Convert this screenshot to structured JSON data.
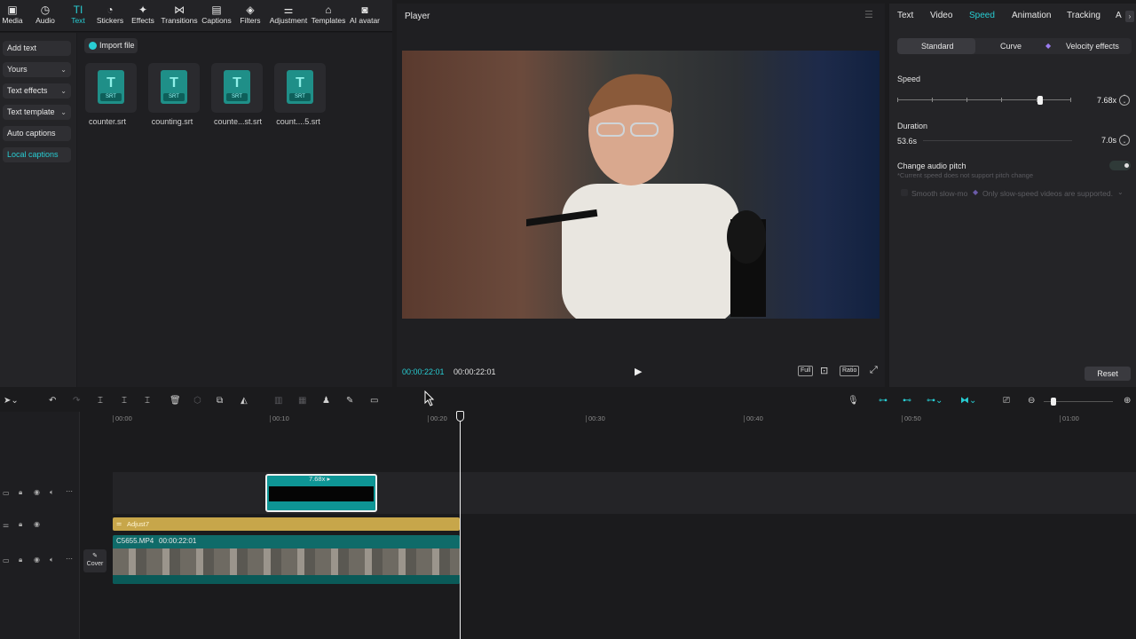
{
  "toolbar": {
    "items": [
      {
        "label": "Media",
        "icon": "media-icon"
      },
      {
        "label": "Audio",
        "icon": "audio-icon"
      },
      {
        "label": "Text",
        "icon": "text-icon"
      },
      {
        "label": "Stickers",
        "icon": "sticker-icon"
      },
      {
        "label": "Effects",
        "icon": "effects-icon"
      },
      {
        "label": "Transitions",
        "icon": "transition-icon"
      },
      {
        "label": "Captions",
        "icon": "captions-icon"
      },
      {
        "label": "Filters",
        "icon": "filters-icon"
      },
      {
        "label": "Adjustment",
        "icon": "adjustment-icon"
      },
      {
        "label": "Templates",
        "icon": "templates-icon"
      },
      {
        "label": "AI avatar",
        "icon": "avatar-icon"
      }
    ],
    "active": "Text"
  },
  "left_nav": {
    "items": [
      {
        "label": "Add text"
      },
      {
        "label": "Yours"
      },
      {
        "label": "Text effects"
      },
      {
        "label": "Text template"
      },
      {
        "label": "Auto captions"
      },
      {
        "label": "Local captions"
      }
    ]
  },
  "media": {
    "import_label": "Import file",
    "files": [
      {
        "name": "counter.srt",
        "badge": "SRT"
      },
      {
        "name": "counting.srt",
        "badge": "SRT"
      },
      {
        "name": "counte...st.srt",
        "badge": "SRT"
      },
      {
        "name": "count....5.srt",
        "badge": "SRT"
      }
    ]
  },
  "player": {
    "title": "Player",
    "current_time": "00:00:22:01",
    "total_time": "00:00:22:01",
    "controls": [
      "Full",
      "Ratio"
    ]
  },
  "right_panel": {
    "tabs": [
      "Text",
      "Video",
      "Speed",
      "Animation",
      "Tracking",
      "A"
    ],
    "active_tab": "Speed",
    "modes": [
      "Standard",
      "Curve",
      "Velocity effects"
    ],
    "active_mode": "Standard",
    "speed_label": "Speed",
    "speed_value": "7.68x",
    "speed_fraction": 0.82,
    "duration_label": "Duration",
    "duration_original": "53.6s",
    "duration_value": "7.0s",
    "pitch_label": "Change audio pitch",
    "pitch_note": "*Current speed does not support pitch change",
    "slowmo_label": "Smooth slow-mo",
    "slowmo_note": "Only slow-speed videos are supported.",
    "reset_label": "Reset"
  },
  "timeline": {
    "ruler": [
      "00:00",
      "00:10",
      "00:20",
      "00:30",
      "00:40",
      "00:50",
      "01:00"
    ],
    "speed_clip_label": "7.68x",
    "adjust_label": "Adjust7",
    "clip_name": "C5655.MP4",
    "clip_duration": "00:00:22:01",
    "cover_label": "Cover"
  },
  "colors": {
    "accent": "#28cdd3",
    "clip_teal": "#0f6b69",
    "adjust_gold": "#c7a64a"
  }
}
